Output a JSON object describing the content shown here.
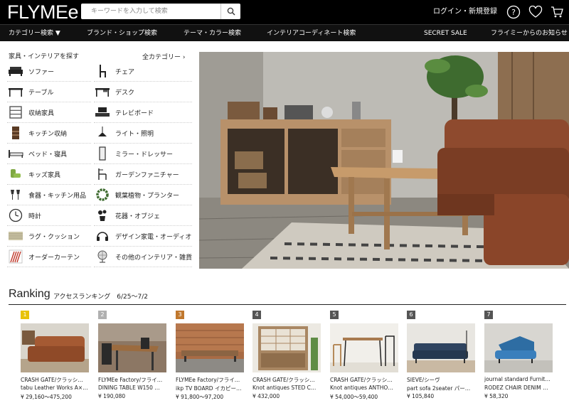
{
  "header": {
    "logo": "FLYMEe",
    "search_placeholder": "キーワードを入力して検索",
    "login_label": "ログイン・新規登録",
    "icons": [
      "search-icon",
      "help-icon",
      "heart-icon",
      "cart-icon"
    ]
  },
  "nav": {
    "items": [
      "カテゴリー検索 ▼",
      "ブランド・ショップ検索",
      "テーマ・カラー検索",
      "インテリアコーディネート検索",
      "SECRET SALE",
      "フライミーからのお知らせ"
    ]
  },
  "categories": {
    "heading": "家具・インテリアを探す",
    "all_label": "全カテゴリー",
    "left": [
      {
        "label": "ソファー",
        "icon": "sofa-icon"
      },
      {
        "label": "テーブル",
        "icon": "table-icon"
      },
      {
        "label": "収納家具",
        "icon": "shelf-icon"
      },
      {
        "label": "キッチン収納",
        "icon": "kitchen-cabinet-icon"
      },
      {
        "label": "ベッド・寝具",
        "icon": "bed-icon"
      },
      {
        "label": "キッズ家具",
        "icon": "kids-chair-icon"
      },
      {
        "label": "食器・キッチン用品",
        "icon": "glasses-icon"
      },
      {
        "label": "時計",
        "icon": "clock-icon"
      },
      {
        "label": "ラグ・クッション",
        "icon": "rug-icon"
      },
      {
        "label": "オーダーカーテン",
        "icon": "curtain-icon"
      }
    ],
    "right": [
      {
        "label": "チェア",
        "icon": "chair-icon"
      },
      {
        "label": "デスク",
        "icon": "desk-icon"
      },
      {
        "label": "テレビボード",
        "icon": "tv-board-icon"
      },
      {
        "label": "ライト・照明",
        "icon": "lamp-icon"
      },
      {
        "label": "ミラー・ドレッサー",
        "icon": "mirror-icon"
      },
      {
        "label": "ガーデンファニチャー",
        "icon": "garden-chair-icon"
      },
      {
        "label": "観葉植物・プランター",
        "icon": "wreath-icon"
      },
      {
        "label": "花器・オブジェ",
        "icon": "vase-icon"
      },
      {
        "label": "デザイン家電・オーディオ",
        "icon": "headphones-icon"
      },
      {
        "label": "その他のインテリア・雑貨",
        "icon": "globe-icon"
      }
    ]
  },
  "ranking": {
    "title": "Ranking",
    "subtitle": "アクセスランキング　6/25〜7/2",
    "items": [
      {
        "rank": "1",
        "badge_color": "#e8c20a",
        "brand": "CRASH GATE/クラッシ…",
        "name": "tabu Leather Works A×…",
        "price": "¥ 29,160〜475,200",
        "icon": "leather-sofa-photo"
      },
      {
        "rank": "2",
        "badge_color": "#b0b0b0",
        "brand": "FLYMEe Factory/フライ…",
        "name": "DINING TABLE W150 …",
        "price": "¥ 190,080",
        "icon": "dining-table-photo"
      },
      {
        "rank": "3",
        "badge_color": "#c0782e",
        "brand": "FLYMEe Factory/フライ…",
        "name": "ikp TV BOARD イカピー…",
        "price": "¥ 91,800〜97,200",
        "icon": "tv-board-photo"
      },
      {
        "rank": "4",
        "badge_color": "#555555",
        "brand": "CRASH GATE/クラッシ…",
        "name": "Knot antiques STED C…",
        "price": "¥ 432,000",
        "icon": "cupboard-photo"
      },
      {
        "rank": "5",
        "badge_color": "#555555",
        "brand": "CRASH GATE/クラッシ…",
        "name": "Knot antiques ANTHO…",
        "price": "¥ 54,000〜59,400",
        "icon": "table-chairs-photo"
      },
      {
        "rank": "6",
        "badge_color": "#555555",
        "brand": "SIEVE/シーヴ",
        "name": "part sofa 2seater パー…",
        "price": "¥ 105,840",
        "icon": "blue-sofa-photo"
      },
      {
        "rank": "7",
        "badge_color": "#555555",
        "brand": "journal standard Furnit…",
        "name": "RODEZ CHAIR DENIM …",
        "price": "¥ 58,320",
        "icon": "denim-chair-photo"
      }
    ]
  }
}
